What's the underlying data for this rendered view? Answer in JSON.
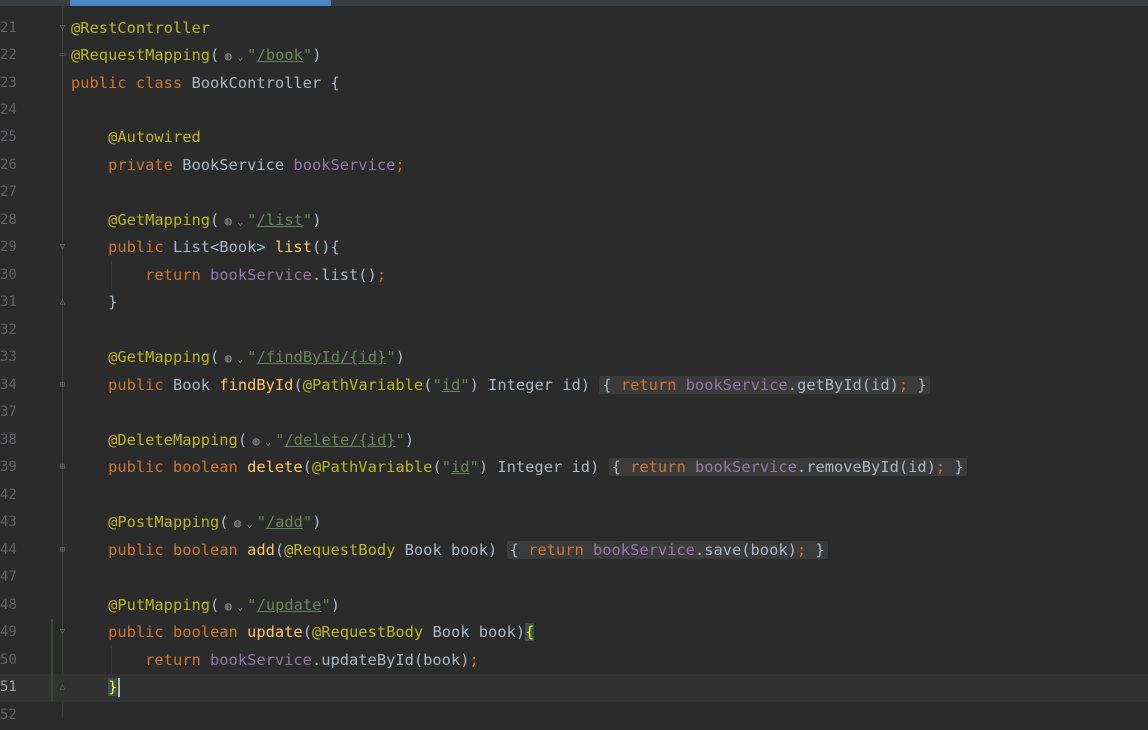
{
  "editor": {
    "current_line": 51,
    "line_numbers": [
      21,
      22,
      23,
      24,
      25,
      26,
      27,
      28,
      29,
      30,
      31,
      32,
      33,
      34,
      37,
      38,
      39,
      42,
      43,
      44,
      47,
      48,
      49,
      50,
      51,
      52
    ],
    "colors": {
      "background": "#2b2b2b",
      "keyword": "#cc7832",
      "annotation": "#bbb529",
      "string": "#6a8759",
      "field": "#9876aa",
      "method": "#ffc66d",
      "text": "#a9b7c6",
      "line_number": "#606366"
    },
    "icons": [
      "globe-icon",
      "chevron-down-icon",
      "fold-icon"
    ]
  },
  "code": {
    "l21": {
      "ann": "@RestController"
    },
    "l22": {
      "ann": "@RequestMapping",
      "open": "(",
      "path": "/book",
      "close": ")"
    },
    "l23": {
      "kw": "public class ",
      "name": "BookController ",
      "brace": "{"
    },
    "l25": {
      "ann": "@Autowired"
    },
    "l26": {
      "kw": "private ",
      "type": "BookService ",
      "field": "bookService",
      "semi": ";"
    },
    "l28": {
      "ann": "@GetMapping",
      "open": "(",
      "path": "/list",
      "close": ")"
    },
    "l29": {
      "kw": "public ",
      "type": "List<Book> ",
      "fn": "list",
      "rest": "(){"
    },
    "l30": {
      "kw": "return ",
      "field": "bookService",
      "call": ".list()",
      "semi": ";"
    },
    "l31": {
      "brace": "}"
    },
    "l33": {
      "ann": "@GetMapping",
      "open": "(",
      "path": "/findById/{id}",
      "close": ")"
    },
    "l34": {
      "kw": "public ",
      "type": "Book ",
      "fn": "findById",
      "open": "(",
      "ann": "@PathVariable",
      "p1": "(",
      "id": "id",
      "p2": ") Integer id) ",
      "fold_open": "{ ",
      "kw2": "return ",
      "field": "bookService",
      "call": ".getById(id)",
      "semi": ";",
      "fold_close": " }"
    },
    "l38": {
      "ann": "@DeleteMapping",
      "open": "(",
      "path": "/delete/{id}",
      "close": ")"
    },
    "l39": {
      "kw": "public boolean ",
      "fn": "delete",
      "open": "(",
      "ann": "@PathVariable",
      "p1": "(",
      "id": "id",
      "p2": ") Integer id) ",
      "fold_open": "{ ",
      "kw2": "return ",
      "field": "bookService",
      "call": ".removeById(id)",
      "semi": ";",
      "fold_close": " }"
    },
    "l43": {
      "ann": "@PostMapping",
      "open": "(",
      "path": "/add",
      "close": ")"
    },
    "l44": {
      "kw": "public boolean ",
      "fn": "add",
      "open": "(",
      "ann": "@RequestBody",
      "p2": " Book book) ",
      "fold_open": "{ ",
      "kw2": "return ",
      "field": "bookService",
      "call": ".save(book)",
      "semi": ";",
      "fold_close": " }"
    },
    "l48": {
      "ann": "@PutMapping",
      "open": "(",
      "path": "/update",
      "close": ")"
    },
    "l49": {
      "kw": "public boolean ",
      "fn": "update",
      "open": "(",
      "ann": "@RequestBody",
      "p2": " Book book)",
      "brace": "{"
    },
    "l50": {
      "kw": "return ",
      "field": "bookService",
      "call": ".updateById(book)",
      "semi": ";"
    },
    "l51": {
      "brace": "}"
    }
  }
}
